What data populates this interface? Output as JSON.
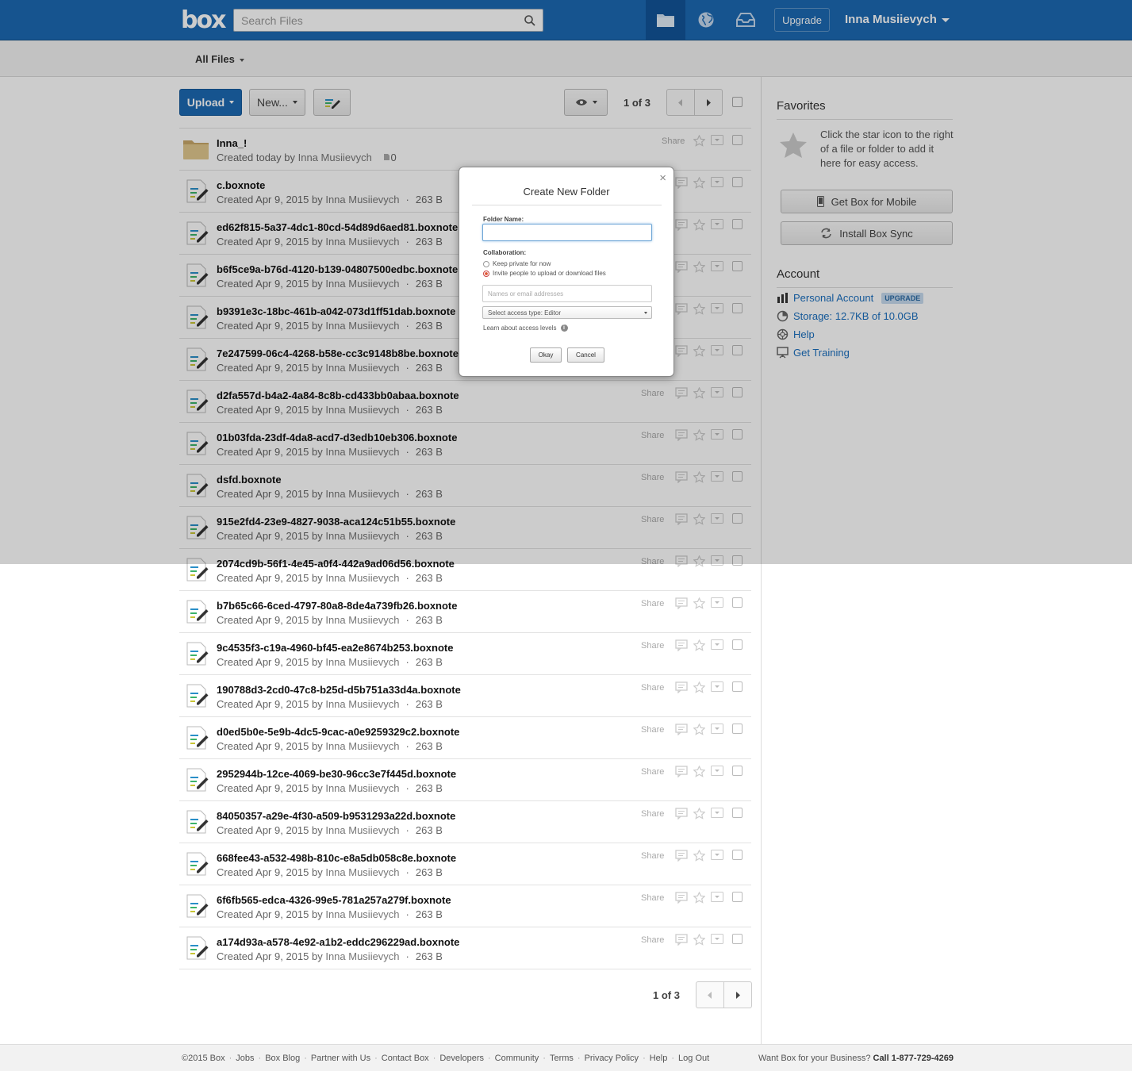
{
  "header": {
    "logo": "box",
    "search_placeholder": "Search Files",
    "upgrade_label": "Upgrade",
    "user_name": "Inna Musiievych",
    "accent_color": "#1c69b3"
  },
  "subheader": {
    "all_files_label": "All Files"
  },
  "toolbar": {
    "upload_label": "Upload",
    "new_label": "New...",
    "page_indicator": "1 of 3"
  },
  "files": [
    {
      "name": "Inna_!",
      "meta": "Created today by",
      "author": "Inna Musiievych",
      "extra": "0",
      "type": "folder"
    },
    {
      "name": "c.boxnote",
      "meta": "Created Apr 9, 2015 by",
      "author": "Inna Musiievych",
      "size": "263 B",
      "type": "note"
    },
    {
      "name": "ed62f815-5a37-4dc1-80cd-54d89d6aed81.boxnote",
      "meta": "Created Apr 9, 2015 by",
      "author": "Inna Musiievych",
      "size": "263 B",
      "type": "note"
    },
    {
      "name": "b6f5ce9a-b76d-4120-b139-04807500edbc.boxnote",
      "meta": "Created Apr 9, 2015 by",
      "author": "Inna Musiievych",
      "size": "263 B",
      "type": "note"
    },
    {
      "name": "b9391e3c-18bc-461b-a042-073d1ff51dab.boxnote",
      "meta": "Created Apr 9, 2015 by",
      "author": "Inna Musiievych",
      "size": "263 B",
      "type": "note"
    },
    {
      "name": "7e247599-06c4-4268-b58e-cc3c9148b8be.boxnote",
      "meta": "Created Apr 9, 2015 by",
      "author": "Inna Musiievych",
      "size": "263 B",
      "type": "note"
    },
    {
      "name": "d2fa557d-b4a2-4a84-8c8b-cd433bb0abaa.boxnote",
      "meta": "Created Apr 9, 2015 by",
      "author": "Inna Musiievych",
      "size": "263 B",
      "type": "note"
    },
    {
      "name": "01b03fda-23df-4da8-acd7-d3edb10eb306.boxnote",
      "meta": "Created Apr 9, 2015 by",
      "author": "Inna Musiievych",
      "size": "263 B",
      "type": "note"
    },
    {
      "name": "dsfd.boxnote",
      "meta": "Created Apr 9, 2015 by",
      "author": "Inna Musiievych",
      "size": "263 B",
      "type": "note"
    },
    {
      "name": "915e2fd4-23e9-4827-9038-aca124c51b55.boxnote",
      "meta": "Created Apr 9, 2015 by",
      "author": "Inna Musiievych",
      "size": "263 B",
      "type": "note"
    },
    {
      "name": "2074cd9b-56f1-4e45-a0f4-442a9ad06d56.boxnote",
      "meta": "Created Apr 9, 2015 by",
      "author": "Inna Musiievych",
      "size": "263 B",
      "type": "note"
    },
    {
      "name": "b7b65c66-6ced-4797-80a8-8de4a739fb26.boxnote",
      "meta": "Created Apr 9, 2015 by",
      "author": "Inna Musiievych",
      "size": "263 B",
      "type": "note"
    },
    {
      "name": "9c4535f3-c19a-4960-bf45-ea2e8674b253.boxnote",
      "meta": "Created Apr 9, 2015 by",
      "author": "Inna Musiievych",
      "size": "263 B",
      "type": "note"
    },
    {
      "name": "190788d3-2cd0-47c8-b25d-d5b751a33d4a.boxnote",
      "meta": "Created Apr 9, 2015 by",
      "author": "Inna Musiievych",
      "size": "263 B",
      "type": "note"
    },
    {
      "name": "d0ed5b0e-5e9b-4dc5-9cac-a0e9259329c2.boxnote",
      "meta": "Created Apr 9, 2015 by",
      "author": "Inna Musiievych",
      "size": "263 B",
      "type": "note"
    },
    {
      "name": "2952944b-12ce-4069-be30-96cc3e7f445d.boxnote",
      "meta": "Created Apr 9, 2015 by",
      "author": "Inna Musiievych",
      "size": "263 B",
      "type": "note"
    },
    {
      "name": "84050357-a29e-4f30-a509-b9531293a22d.boxnote",
      "meta": "Created Apr 9, 2015 by",
      "author": "Inna Musiievych",
      "size": "263 B",
      "type": "note"
    },
    {
      "name": "668fee43-a532-498b-810c-e8a5db058c8e.boxnote",
      "meta": "Created Apr 9, 2015 by",
      "author": "Inna Musiievych",
      "size": "263 B",
      "type": "note"
    },
    {
      "name": "6f6fb565-edca-4326-99e5-781a257a279f.boxnote",
      "meta": "Created Apr 9, 2015 by",
      "author": "Inna Musiievych",
      "size": "263 B",
      "type": "note"
    },
    {
      "name": "a174d93a-a578-4e92-a1b2-eddc296229ad.boxnote",
      "meta": "Created Apr 9, 2015 by",
      "author": "Inna Musiievych",
      "size": "263 B",
      "type": "note"
    }
  ],
  "row_share_label": "Share",
  "pager_bottom": "1 of 3",
  "sidebar": {
    "favorites_title": "Favorites",
    "favorites_text": "Click the star icon to the right of a file or folder to add it here for easy access.",
    "mobile_btn": "Get Box for Mobile",
    "sync_btn": "Install Box Sync",
    "account_title": "Account",
    "personal_account": "Personal Account",
    "upgrade_badge": "UPGRADE",
    "storage": "Storage: 12.7KB of 10.0GB",
    "help": "Help",
    "training": "Get Training"
  },
  "footer": {
    "links": [
      "©2015 Box",
      "Jobs",
      "Box Blog",
      "Partner with Us",
      "Contact Box",
      "Developers",
      "Community",
      "Terms",
      "Privacy Policy",
      "Help",
      "Log Out"
    ],
    "business_text": "Want Box for your Business?",
    "call_text": "Call 1-877-729-4269"
  },
  "dialog": {
    "close": "×",
    "title": "Create New Folder",
    "folder_name_label": "Folder Name:",
    "folder_name_value": "",
    "collaboration_label": "Collaboration:",
    "option_private": "Keep private for now",
    "option_invite": "Invite people to upload or download files",
    "selected_option": "invite",
    "names_placeholder": "Names or email addresses",
    "access_type": "Select access type: Editor",
    "learn_link": "Learn about access levels",
    "okay": "Okay",
    "cancel": "Cancel"
  }
}
